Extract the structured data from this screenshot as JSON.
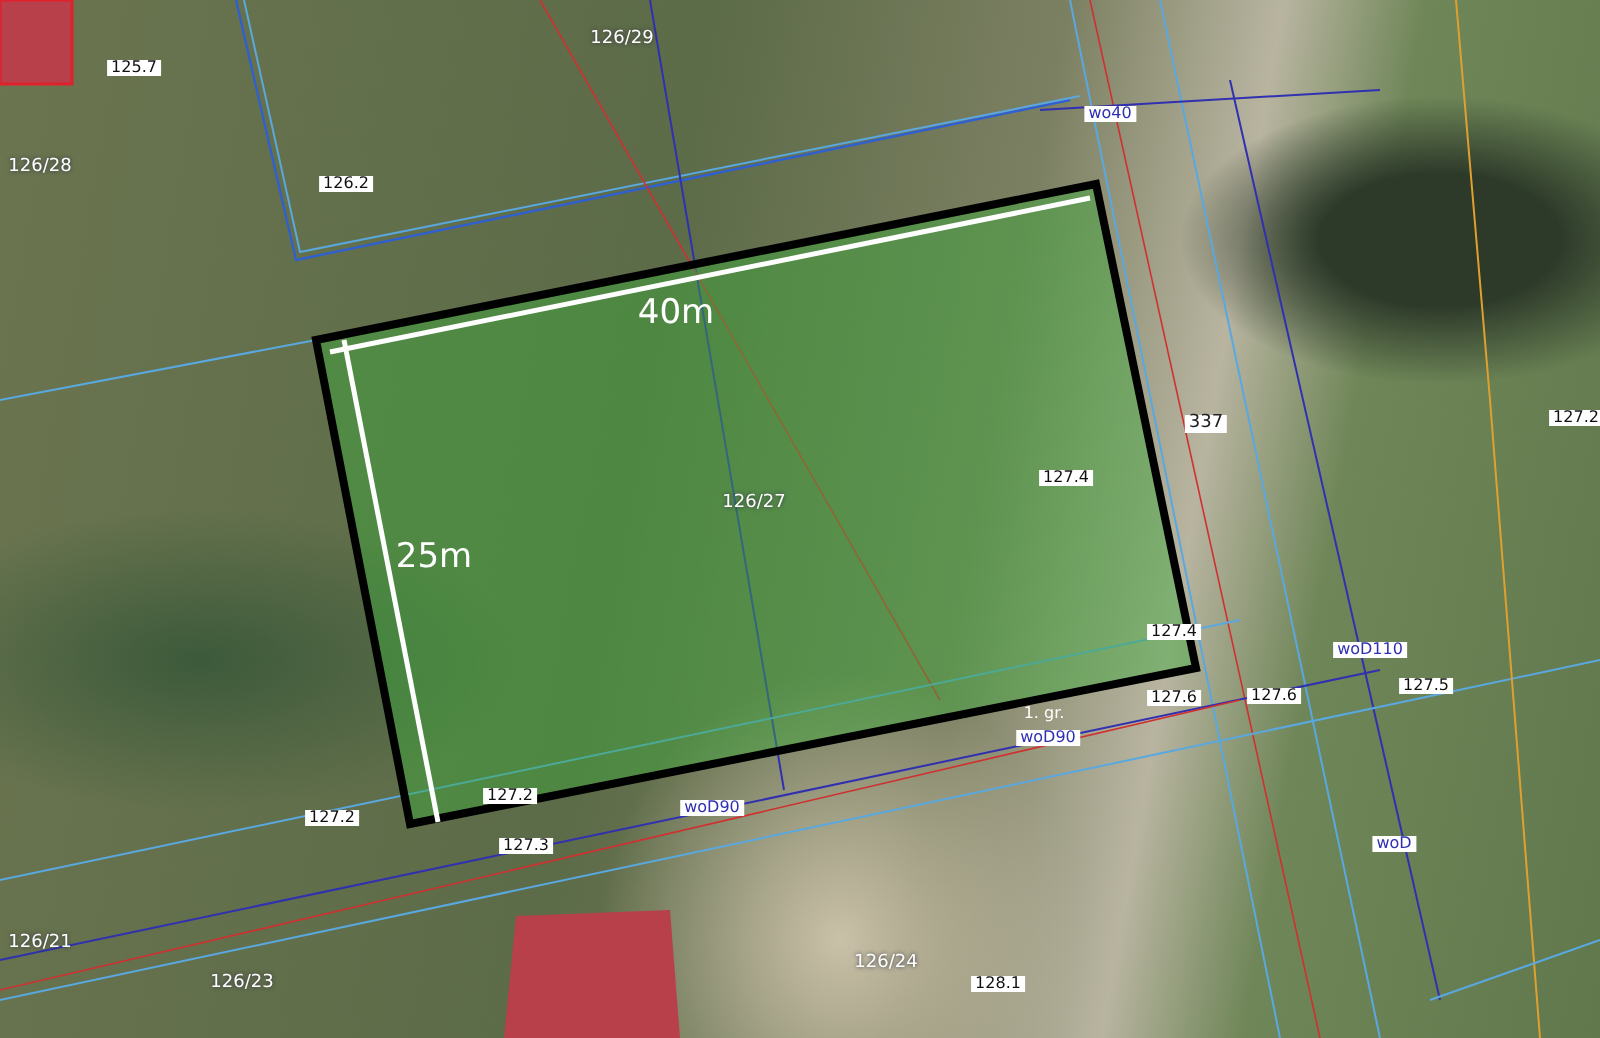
{
  "map": {
    "labels": [
      {
        "text": "125.7",
        "kind": "height"
      },
      {
        "text": "126/28",
        "kind": "parcel"
      },
      {
        "text": "126/29",
        "kind": "parcel"
      },
      {
        "text": "126.2",
        "kind": "height"
      },
      {
        "text": "wo40",
        "kind": "utility"
      },
      {
        "text": "40m",
        "kind": "dimension"
      },
      {
        "text": "337",
        "kind": "road"
      },
      {
        "text": "127.4",
        "kind": "height"
      },
      {
        "text": "127.2",
        "kind": "height"
      },
      {
        "text": "126/27",
        "kind": "parcel"
      },
      {
        "text": "25m",
        "kind": "dimension"
      },
      {
        "text": "127.4",
        "kind": "height"
      },
      {
        "text": "woD110",
        "kind": "utility"
      },
      {
        "text": "127.5",
        "kind": "height"
      },
      {
        "text": "127.6",
        "kind": "height"
      },
      {
        "text": "127.6",
        "kind": "height"
      },
      {
        "text": "1. gr.",
        "kind": "note"
      },
      {
        "text": "woD90",
        "kind": "utility"
      },
      {
        "text": "127.2",
        "kind": "height"
      },
      {
        "text": "127.2",
        "kind": "height"
      },
      {
        "text": "woD90",
        "kind": "utility"
      },
      {
        "text": "127.3",
        "kind": "height"
      },
      {
        "text": "woD",
        "kind": "utility"
      },
      {
        "text": "126/21",
        "kind": "parcel"
      },
      {
        "text": "126/23",
        "kind": "parcel"
      },
      {
        "text": "126/24",
        "kind": "parcel"
      },
      {
        "text": "128.1",
        "kind": "height"
      }
    ]
  }
}
